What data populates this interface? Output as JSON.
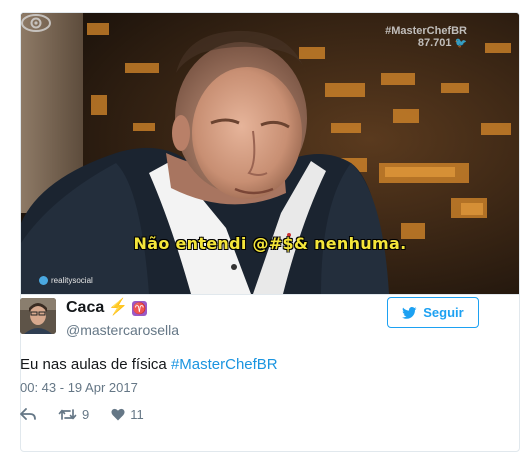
{
  "media": {
    "overlay_hashtag": "#MasterChefBR",
    "overlay_count": "87.701",
    "subtitle": "Não entendi @#$& nenhuma.",
    "watermark": "realitysocial"
  },
  "author": {
    "display_name": "Caca",
    "emoji_bolt": "⚡",
    "emoji_zodiac": "♈",
    "handle": "@mastercarosella"
  },
  "follow_button": {
    "label": "Seguir"
  },
  "tweet": {
    "text": "Eu nas aulas de física ",
    "hashtag": "#MasterChefBR",
    "timestamp": "00: 43 - 19 Apr 2017"
  },
  "actions": {
    "reply_icon": "reply-icon",
    "retweet_icon": "retweet-icon",
    "retweet_count": "9",
    "like_icon": "heart-icon",
    "like_count": "11"
  },
  "colors": {
    "accent": "#1da1f2",
    "hashtag": "#1b95e0",
    "muted": "#657786",
    "subtitle": "#f4e53a"
  }
}
